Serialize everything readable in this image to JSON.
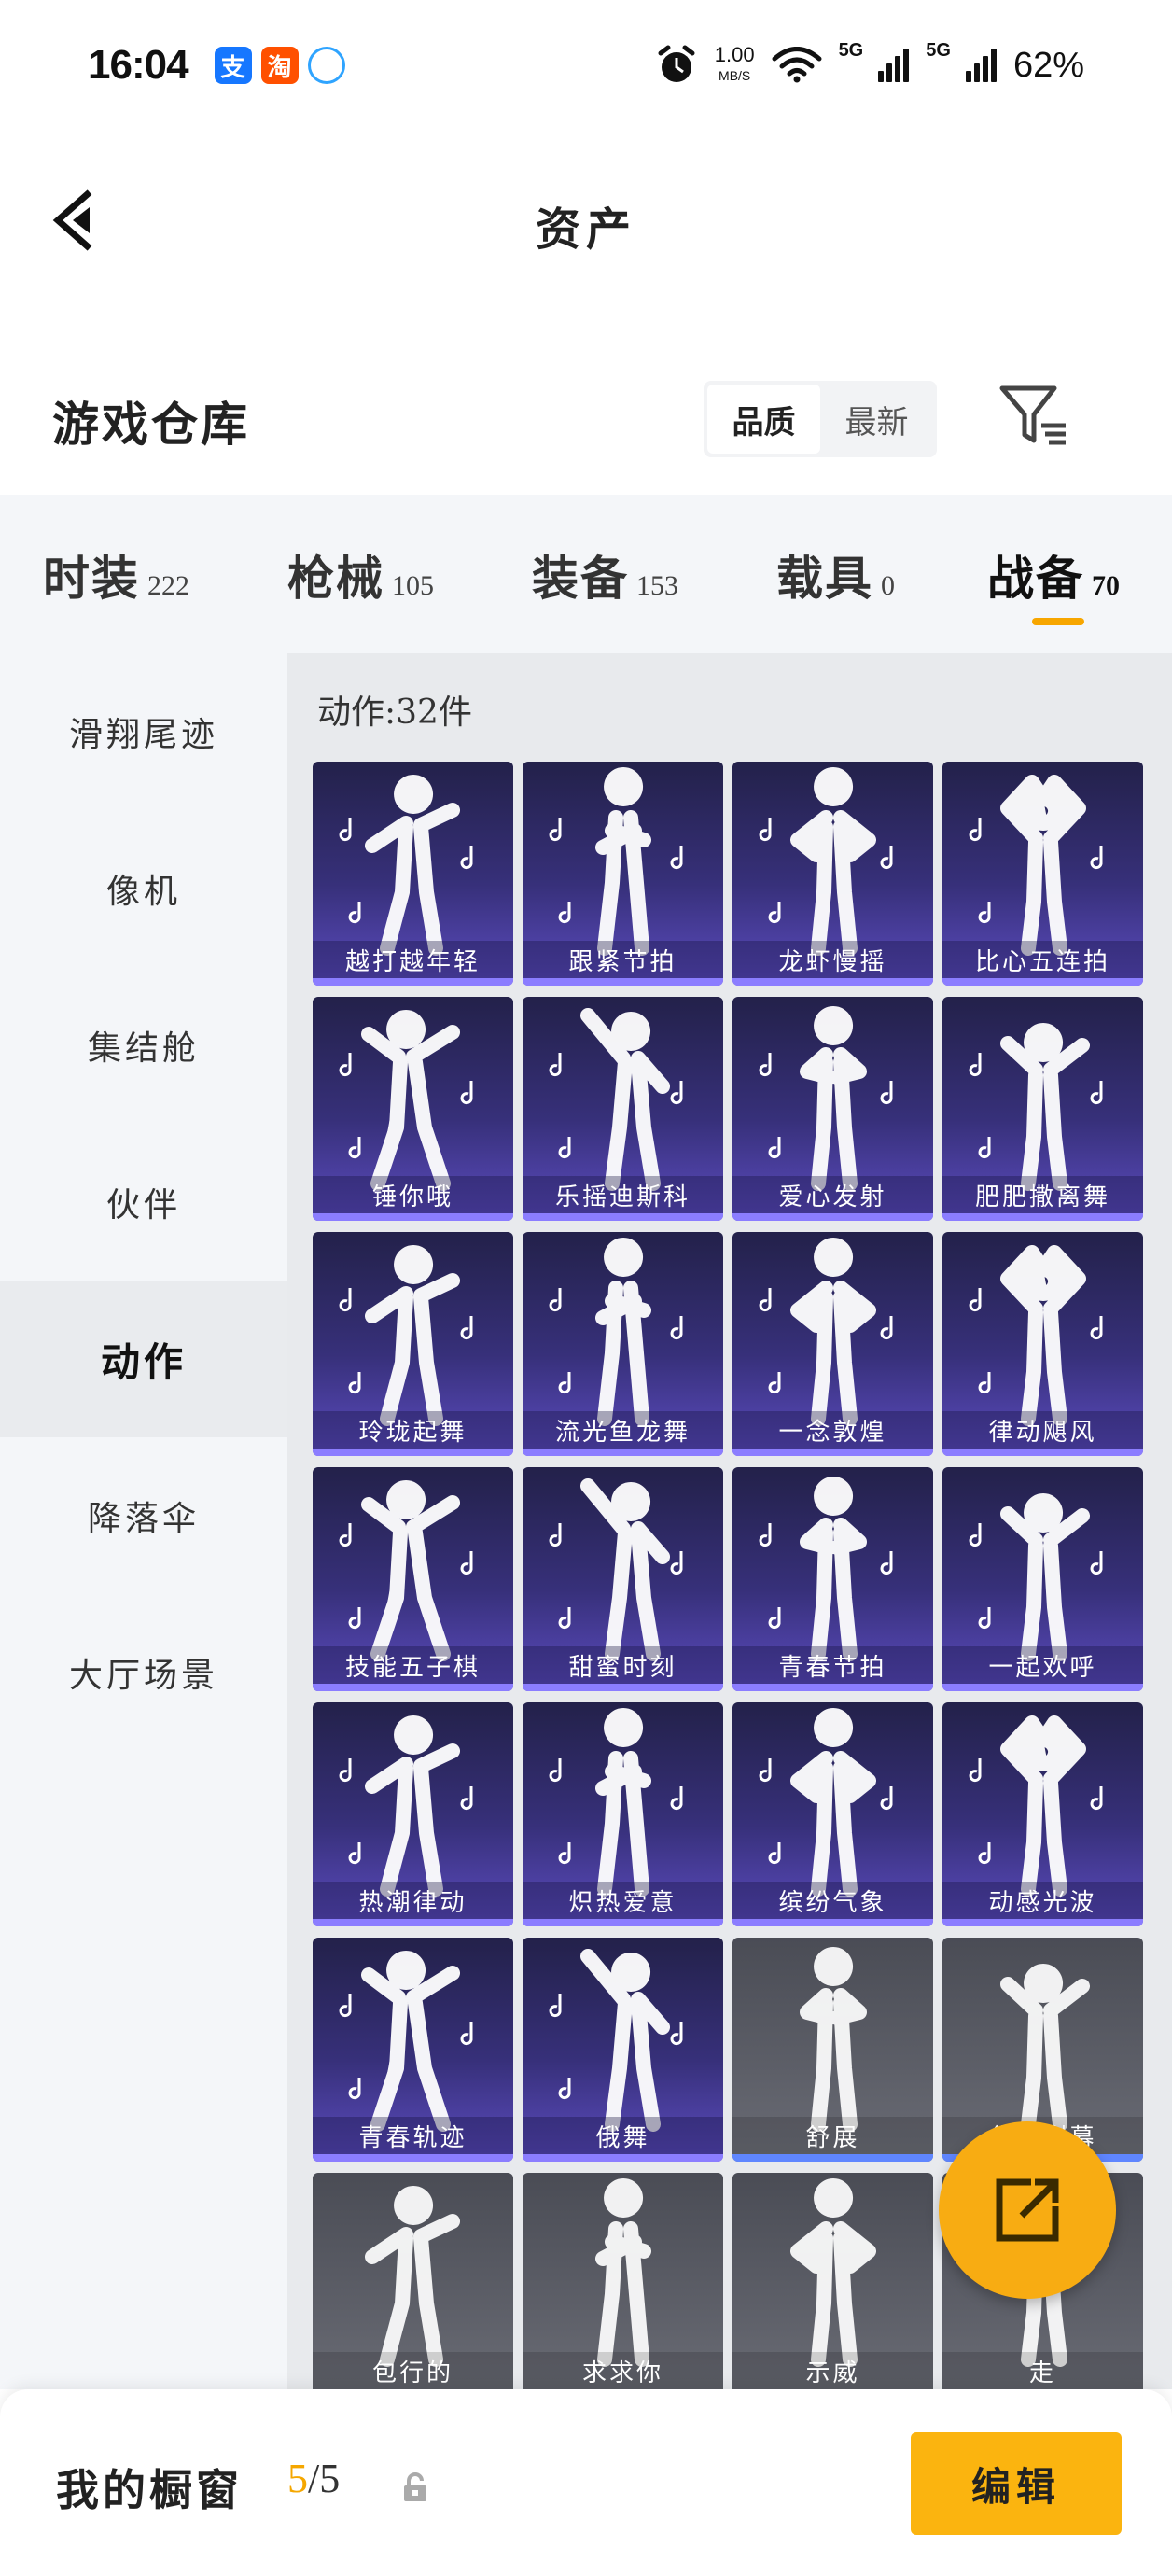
{
  "status_bar": {
    "time": "16:04",
    "app_icons": [
      {
        "name": "alipay-icon",
        "glyph": "支"
      },
      {
        "name": "taobao-icon",
        "glyph": "淘"
      },
      {
        "name": "qq-browser-icon",
        "glyph": ""
      }
    ],
    "speed_value": "1.00",
    "speed_unit": "MB/S",
    "net1": "5G",
    "net2": "5G",
    "battery": "62%"
  },
  "header": {
    "title": "资产"
  },
  "section": {
    "title": "游戏仓库",
    "sort_options": [
      "品质",
      "最新"
    ],
    "sort_selected": "品质"
  },
  "categories": [
    {
      "name": "时装",
      "count": "222"
    },
    {
      "name": "枪械",
      "count": "105"
    },
    {
      "name": "装备",
      "count": "153"
    },
    {
      "name": "载具",
      "count": "0"
    },
    {
      "name": "战备",
      "count": "70",
      "active": true
    }
  ],
  "sidebar": {
    "items": [
      {
        "label": "滑翔尾迹"
      },
      {
        "label": "像机"
      },
      {
        "label": "集结舱"
      },
      {
        "label": "伙伴"
      },
      {
        "label": "动作",
        "active": true
      },
      {
        "label": "降落伞"
      },
      {
        "label": "大厅场景"
      }
    ]
  },
  "main": {
    "count_label": "动作:32件",
    "items": [
      {
        "label": "越打越年轻",
        "tier": "purple"
      },
      {
        "label": "跟紧节拍",
        "tier": "purple"
      },
      {
        "label": "龙虾慢摇",
        "tier": "purple"
      },
      {
        "label": "比心五连拍",
        "tier": "purple"
      },
      {
        "label": "锤你哦",
        "tier": "purple"
      },
      {
        "label": "乐摇迪斯科",
        "tier": "purple"
      },
      {
        "label": "爱心发射",
        "tier": "purple"
      },
      {
        "label": "肥肥撒离舞",
        "tier": "purple"
      },
      {
        "label": "玲珑起舞",
        "tier": "purple"
      },
      {
        "label": "流光鱼龙舞",
        "tier": "purple"
      },
      {
        "label": "一念敦煌",
        "tier": "purple"
      },
      {
        "label": "律动飓风",
        "tier": "purple"
      },
      {
        "label": "技能五子棋",
        "tier": "purple"
      },
      {
        "label": "甜蜜时刻",
        "tier": "purple"
      },
      {
        "label": "青春节拍",
        "tier": "purple"
      },
      {
        "label": "一起欢呼",
        "tier": "purple"
      },
      {
        "label": "热潮律动",
        "tier": "purple"
      },
      {
        "label": "炽热爱意",
        "tier": "purple"
      },
      {
        "label": "缤纷气象",
        "tier": "purple"
      },
      {
        "label": "动感光波",
        "tier": "purple"
      },
      {
        "label": "青春轨迹",
        "tier": "purple"
      },
      {
        "label": "俄舞",
        "tier": "purple"
      },
      {
        "label": "舒展",
        "tier": "gray"
      },
      {
        "label": "华丽谢幕",
        "tier": "gray"
      },
      {
        "label": "包行的",
        "tier": "gray"
      },
      {
        "label": "求求你",
        "tier": "gray"
      },
      {
        "label": "示威",
        "tier": "gray"
      },
      {
        "label": "走",
        "tier": "gray"
      }
    ]
  },
  "fab": {
    "icon": "share-out-icon"
  },
  "bottom_bar": {
    "title": "我的橱窗",
    "used": "5",
    "slash_total": "/5",
    "edit_label": "编辑"
  },
  "colors": {
    "accent": "#f8ac12",
    "card_purple": "#3a3280",
    "card_gray": "#5a5c65"
  }
}
